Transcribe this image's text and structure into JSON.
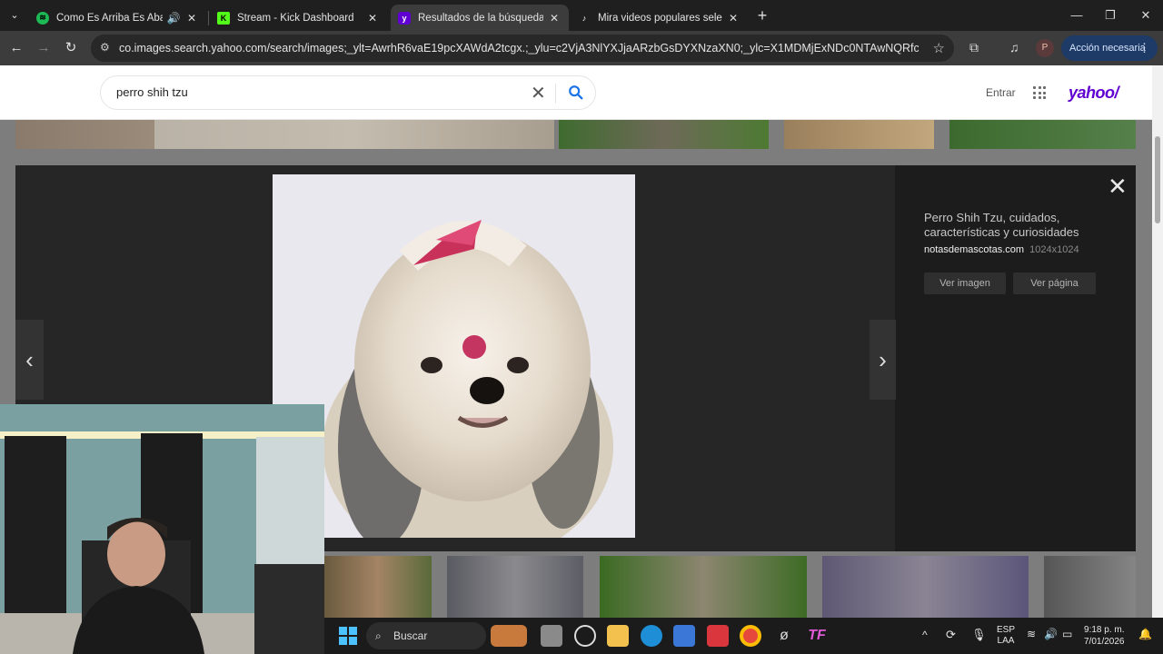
{
  "browser": {
    "tabs": [
      {
        "title": "Como Es Arriba Es Abajo • F",
        "favicon": "spotify-icon",
        "color": "#1db954"
      },
      {
        "title": "Stream - Kick Dashboard",
        "favicon": "kick-icon",
        "color": "#53fc18"
      },
      {
        "title": "Resultados de la búsqueda de i",
        "favicon": "yahoo-icon",
        "color": "#6001d2"
      },
      {
        "title": "Mira videos populares seleccion",
        "favicon": "tiktok-icon",
        "color": "#ffffff"
      }
    ],
    "url": "co.images.search.yahoo.com/search/images;_ylt=AwrhR6vaE19pcXAWdA2tcgx.;_ylu=c2VjA3NlYXJjaARzbGsDYXNzaXN0;_ylc=X1MDMjExNDc0NTAwNQRfcgMyBGZyA21jYX...",
    "profile_initial": "P",
    "action_label": "Acción necesaria"
  },
  "yahoo": {
    "search_value": "perro shih tzu",
    "signin_label": "Entrar",
    "logo": "yahoo/",
    "brand_color": "#6001d2"
  },
  "viewer": {
    "title": "Perro Shih Tzu, cuidados, características y curiosidades",
    "source": "notasdemascotas.com",
    "size": "1024x1024",
    "view_image_label": "Ver imagen",
    "view_page_label": "Ver página"
  },
  "taskbar": {
    "search_label": "Buscar",
    "lang_top": "ESP",
    "lang_bottom": "LAA",
    "time": "9:18 p. m.",
    "date": "7/01/2026"
  }
}
